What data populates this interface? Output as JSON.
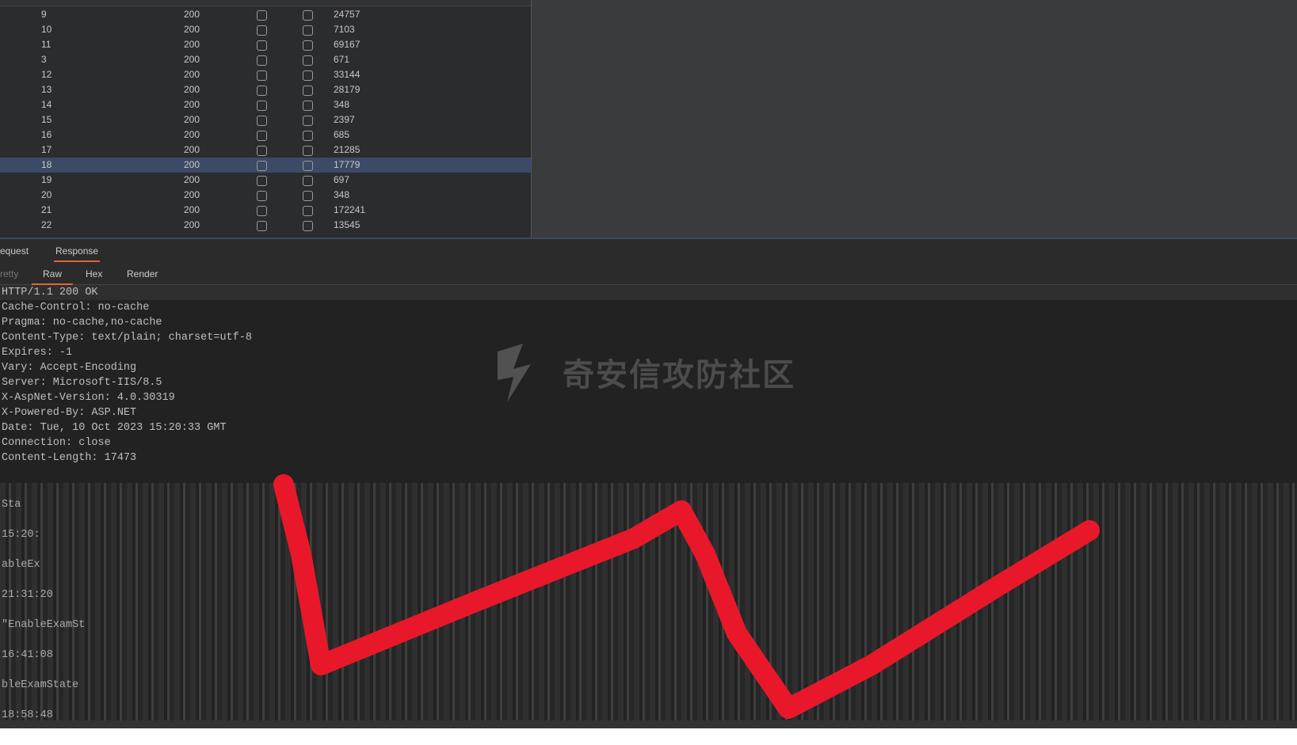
{
  "table": {
    "rows": [
      {
        "request": "9",
        "status": "200",
        "length": "24757"
      },
      {
        "request": "10",
        "status": "200",
        "length": "7103"
      },
      {
        "request": "11",
        "status": "200",
        "length": "69167"
      },
      {
        "request": "3",
        "status": "200",
        "length": "671"
      },
      {
        "request": "12",
        "status": "200",
        "length": "33144"
      },
      {
        "request": "13",
        "status": "200",
        "length": "28179"
      },
      {
        "request": "14",
        "status": "200",
        "length": "348"
      },
      {
        "request": "15",
        "status": "200",
        "length": "2397"
      },
      {
        "request": "16",
        "status": "200",
        "length": "685"
      },
      {
        "request": "17",
        "status": "200",
        "length": "21285"
      },
      {
        "request": "18",
        "status": "200",
        "length": "17779",
        "selected": true
      },
      {
        "request": "19",
        "status": "200",
        "length": "697"
      },
      {
        "request": "20",
        "status": "200",
        "length": "348"
      },
      {
        "request": "21",
        "status": "200",
        "length": "172241"
      },
      {
        "request": "22",
        "status": "200",
        "length": "13545"
      }
    ]
  },
  "tabs": {
    "request": "equest",
    "response": "Response"
  },
  "subtabs": {
    "pretty": "retty",
    "raw": "Raw",
    "hex": "Hex",
    "render": "Render"
  },
  "response_lines": [
    "HTTP/1.1 200 OK",
    "Cache-Control: no-cache",
    "Pragma: no-cache,no-cache",
    "Content-Type: text/plain; charset=utf-8",
    "Expires: -1",
    "Vary: Accept-Encoding",
    "Server: Microsoft-IIS/8.5",
    "X-AspNet-Version: 4.0.30319",
    "X-Powered-By: ASP.NET",
    "Date: Tue, 10 Oct 2023 15:20:33 GMT",
    "Connection: close",
    "Content-Length: 17473"
  ],
  "body_fragments": [
    "Sta",
    "15:20:",
    "ableEx",
    "21:31:20",
    "\"EnableExamSt",
    "16:41:08",
    "bleExamState",
    "18:58:48"
  ],
  "watermark": "奇安信攻防社区",
  "colors": {
    "accent": "#e0643c",
    "selected_row": "#3b4a66",
    "scribble": "#e8182a"
  }
}
